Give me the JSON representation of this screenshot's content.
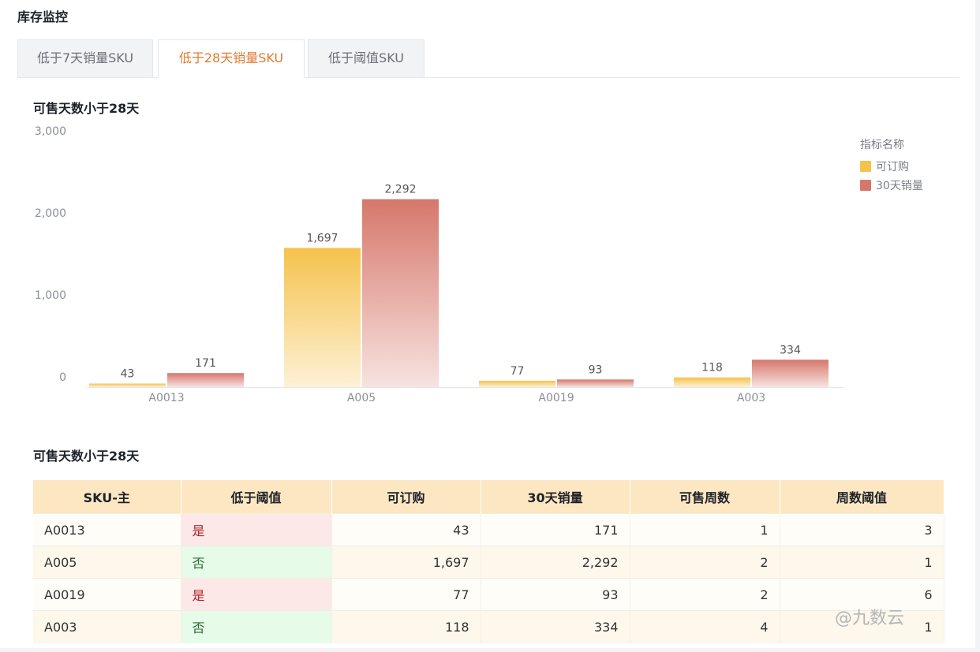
{
  "page": {
    "title": "库存监控"
  },
  "tabs": [
    {
      "label": "低于7天销量SKU",
      "active": false
    },
    {
      "label": "低于28天销量SKU",
      "active": true
    },
    {
      "label": "低于阈值SKU",
      "active": false
    }
  ],
  "chart_section": {
    "title": "可售天数小于28天"
  },
  "table_section": {
    "title": "可售天数小于28天"
  },
  "chart_data": {
    "type": "bar",
    "categories": [
      "A0013",
      "A005",
      "A0019",
      "A003"
    ],
    "series": [
      {
        "name": "可订购",
        "values": [
          43,
          1697,
          77,
          118
        ],
        "color": "#f5c24b"
      },
      {
        "name": "30天销量",
        "values": [
          171,
          2292,
          93,
          334
        ],
        "color": "#d6776b"
      }
    ],
    "title": "",
    "xlabel": "",
    "ylabel": "",
    "ylim": [
      0,
      3000
    ],
    "yticks": [
      "0",
      "1,000",
      "2,000",
      "3,000"
    ],
    "data_labels": true,
    "grid": false,
    "legend": {
      "title": "指标名称",
      "position": "top-right"
    }
  },
  "table": {
    "columns": [
      "SKU-主",
      "低于阈值",
      "可订购",
      "30天销量",
      "可售周数",
      "周数阈值"
    ],
    "rows": [
      [
        "A0013",
        "是",
        "43",
        "171",
        "1",
        "3"
      ],
      [
        "A005",
        "否",
        "1,697",
        "2,292",
        "2",
        "1"
      ],
      [
        "A0019",
        "是",
        "77",
        "93",
        "2",
        "6"
      ],
      [
        "A003",
        "否",
        "118",
        "334",
        "4",
        "1"
      ]
    ]
  },
  "watermark": "@九数云"
}
